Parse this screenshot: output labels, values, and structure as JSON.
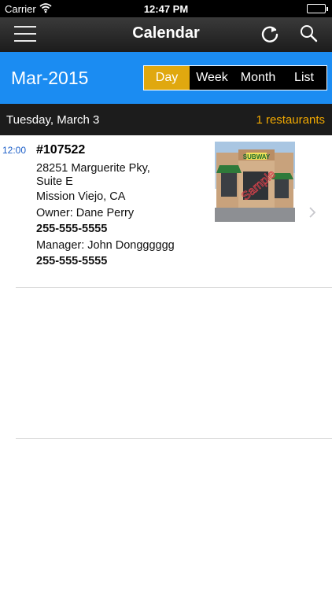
{
  "status_bar": {
    "carrier": "Carrier",
    "time": "12:47 PM"
  },
  "nav": {
    "title": "Calendar",
    "icons": [
      "menu-icon",
      "refresh-icon",
      "search-icon"
    ]
  },
  "month_bar": {
    "month": "Mar-2015",
    "accent_color": "#1b8cf2",
    "tabs": [
      {
        "label": "Day",
        "active": true
      },
      {
        "label": "Week",
        "active": false
      },
      {
        "label": "Month",
        "active": false
      },
      {
        "label": "List",
        "active": false
      }
    ],
    "active_tab_color": "#e0a80f"
  },
  "date_bar": {
    "date": "Tuesday, March 3",
    "count": "1 restaurants",
    "count_color": "#f2a900"
  },
  "entries": [
    {
      "time": "12:00",
      "code": "#107522",
      "address_line1": "28251 Marguerite Pky,",
      "address_line2": "Suite E",
      "city": "Mission Viejo, CA",
      "owner": "Owner: Dane Perry",
      "owner_phone": "255-555-5555",
      "manager": "Manager: John Dongggggg",
      "manager_phone": "255-555-5555",
      "thumbnail_sign": "SUBWAY",
      "thumbnail_watermark": "Sample"
    }
  ]
}
